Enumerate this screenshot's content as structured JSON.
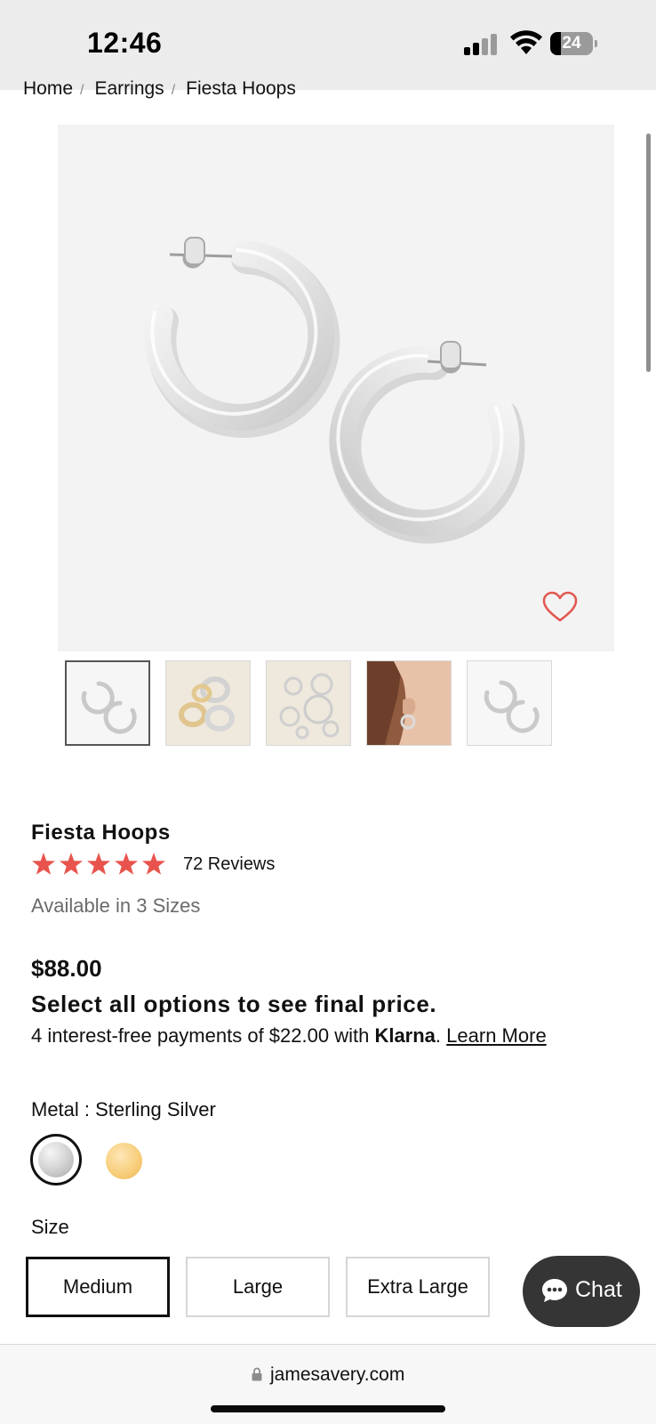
{
  "status_bar": {
    "time": "12:46",
    "battery_level": "24",
    "icons": [
      "signal-icon",
      "wifi-icon",
      "battery-icon"
    ]
  },
  "breadcrumb": {
    "items": [
      "Home",
      "Earrings",
      "Fiesta Hoops"
    ],
    "separator": "/"
  },
  "gallery": {
    "main_image": "silver-hoop-earrings-product-photo",
    "thumbnails": [
      {
        "name": "thumb-silver-hoops",
        "selected": true
      },
      {
        "name": "thumb-mixed-metal-hoops",
        "selected": false
      },
      {
        "name": "thumb-silver-hoop-sizes",
        "selected": false
      },
      {
        "name": "thumb-model-wearing-hoop",
        "selected": false
      },
      {
        "name": "thumb-silver-hoops-alt",
        "selected": false
      }
    ],
    "wishlist_icon": "heart-icon"
  },
  "product": {
    "title": "Fiesta Hoops",
    "rating_stars": 5,
    "rating_color": "#e8544d",
    "reviews": "72 Reviews",
    "availability": "Available in 3 Sizes",
    "price": "$88.00",
    "price_note": "Select all options to see final price.",
    "klarna": {
      "prefix": "4 interest-free payments of $22.00 with ",
      "brand": "Klarna",
      "period": ".",
      "link": "Learn More"
    }
  },
  "metal": {
    "label": "Metal : Sterling Silver",
    "options": [
      {
        "name": "Sterling Silver",
        "color": "#c8c8c8",
        "selected": true
      },
      {
        "name": "Gold",
        "color": "#f6c66a",
        "selected": false
      }
    ]
  },
  "size": {
    "label": "Size",
    "options": [
      {
        "label": "Medium",
        "selected": true
      },
      {
        "label": "Large",
        "selected": false
      },
      {
        "label": "Extra Large",
        "selected": false
      }
    ]
  },
  "chat": {
    "label": "Chat",
    "icon": "chat-bubble-icon"
  },
  "browser": {
    "url": "jamesavery.com",
    "lock_icon": "lock-icon"
  }
}
